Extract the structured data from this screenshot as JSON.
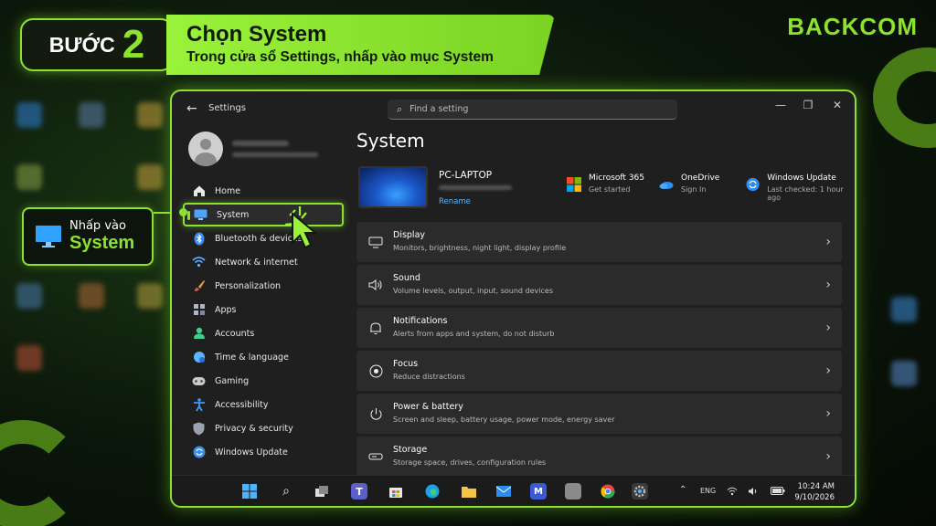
{
  "banner": {
    "step_word": "BƯỚC",
    "step_number": "2",
    "title": "Chọn System",
    "subtitle": "Trong cửa sổ Settings, nhấp vào mục System"
  },
  "brand": "BACKCOM",
  "callout": {
    "line1": "Nhấp vào",
    "line2": "System"
  },
  "window": {
    "title": "Settings",
    "search_placeholder": "Find a setting",
    "controls": {
      "minimize": "—",
      "maximize": "❐",
      "close": "✕"
    }
  },
  "sidebar": {
    "items": [
      {
        "label": "Home",
        "icon": "home-icon",
        "color": "#e8e8e8"
      },
      {
        "label": "System",
        "icon": "display-icon",
        "color": "#4aa3ff",
        "active": true
      },
      {
        "label": "Bluetooth & devices",
        "icon": "bluetooth-icon",
        "color": "#3b8eea"
      },
      {
        "label": "Network & internet",
        "icon": "wifi-icon",
        "color": "#5ab0ff"
      },
      {
        "label": "Personalization",
        "icon": "brush-icon",
        "color": "#e6a34a"
      },
      {
        "label": "Apps",
        "icon": "apps-icon",
        "color": "#a9b7c6"
      },
      {
        "label": "Accounts",
        "icon": "person-icon",
        "color": "#3ecf8e"
      },
      {
        "label": "Time & language",
        "icon": "globe-icon",
        "color": "#5bb6ff"
      },
      {
        "label": "Gaming",
        "icon": "gamepad-icon",
        "color": "#c9c9c9"
      },
      {
        "label": "Accessibility",
        "icon": "accessibility-icon",
        "color": "#3b9bff"
      },
      {
        "label": "Privacy & security",
        "icon": "shield-icon",
        "color": "#9aa3ad"
      },
      {
        "label": "Windows Update",
        "icon": "update-icon",
        "color": "#3b8eea"
      }
    ]
  },
  "main": {
    "title": "System",
    "device": {
      "name": "PC-LAPTOP",
      "rename": "Rename"
    },
    "quick": [
      {
        "title": "Microsoft 365",
        "sub": "Get started",
        "icon": "microsoft-icon"
      },
      {
        "title": "OneDrive",
        "sub": "Sign In",
        "icon": "onedrive-icon"
      },
      {
        "title": "Windows Update",
        "sub": "Last checked: 1 hour ago",
        "icon": "update-icon"
      }
    ],
    "cards": [
      {
        "title": "Display",
        "desc": "Monitors, brightness, night light, display profile",
        "icon": "monitor-icon"
      },
      {
        "title": "Sound",
        "desc": "Volume levels, output, input, sound devices",
        "icon": "speaker-icon"
      },
      {
        "title": "Notifications",
        "desc": "Alerts from apps and system, do not disturb",
        "icon": "bell-icon"
      },
      {
        "title": "Focus",
        "desc": "Reduce distractions",
        "icon": "focus-icon"
      },
      {
        "title": "Power & battery",
        "desc": "Screen and sleep, battery usage, power mode, energy saver",
        "icon": "power-icon"
      },
      {
        "title": "Storage",
        "desc": "Storage space, drives, configuration rules",
        "icon": "storage-icon"
      }
    ]
  },
  "taskbar": {
    "language": "ENG",
    "time": "10:24 AM",
    "date": "9/10/2026"
  }
}
